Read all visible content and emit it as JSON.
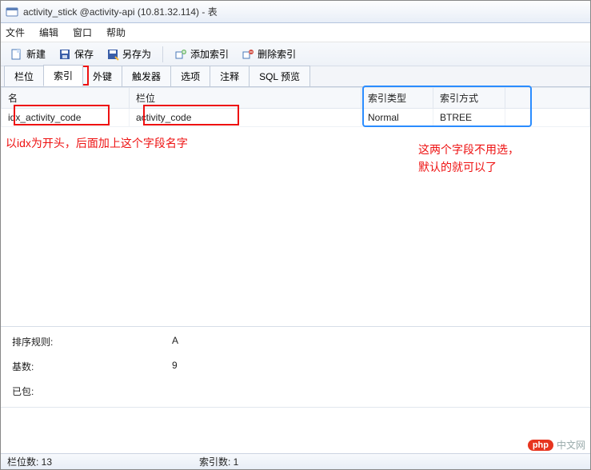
{
  "window": {
    "title": "activity_stick @activity-api (10.81.32.114) - 表"
  },
  "menu": {
    "file": "文件",
    "edit": "编辑",
    "window": "窗口",
    "help": "帮助"
  },
  "toolbar": {
    "new": "新建",
    "save": "保存",
    "save_as": "另存为",
    "add_index": "添加索引",
    "delete_index": "删除索引"
  },
  "tabs": {
    "fields": "栏位",
    "indexes": "索引",
    "fk": "外键",
    "triggers": "触发器",
    "options": "选项",
    "comment": "注释",
    "sql_preview": "SQL 预览"
  },
  "grid": {
    "headers": {
      "name": "名",
      "field": "栏位",
      "index_type": "索引类型",
      "index_method": "索引方式"
    },
    "rows": [
      {
        "name": "idx_activity_code",
        "field": "activity_code",
        "index_type": "Normal",
        "index_method": "BTREE"
      }
    ]
  },
  "annotations": {
    "left": "以idx为开头，后面加上这个字段名字",
    "right_line1": "这两个字段不用选，",
    "right_line2": "默认的就可以了"
  },
  "details": {
    "sort_label": "排序规则:",
    "sort_value": "A",
    "cardinality_label": "基数:",
    "cardinality_value": "9",
    "packed_label": "已包:"
  },
  "watermark": {
    "brand": "php",
    "site": "中文网"
  },
  "status": {
    "fields": "栏位数: 13",
    "indexes": "索引数: 1"
  }
}
